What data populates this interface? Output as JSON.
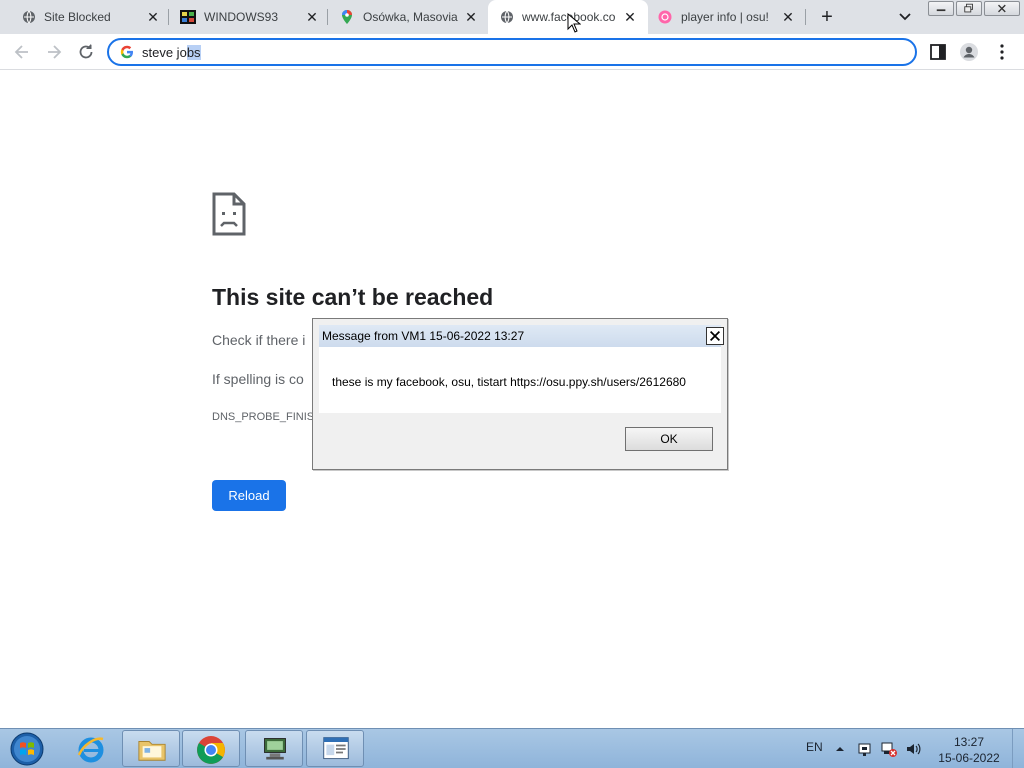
{
  "browser": {
    "tabs": [
      {
        "title": "Site Blocked",
        "icon": "globe-icon"
      },
      {
        "title": "WINDOWS93",
        "icon": "windows93-icon"
      },
      {
        "title": "Osówka, Masovia",
        "icon": "maps-pin-icon"
      },
      {
        "title": "www.facebook.co",
        "icon": "globe-icon",
        "active": true
      },
      {
        "title": "player info | osu!",
        "icon": "osu-icon"
      }
    ],
    "new_tab_label": "+",
    "close_glyph": "✕",
    "omnibox": {
      "text_before_selection": "steve jo",
      "selected_text": "bs"
    }
  },
  "page": {
    "heading": "This site can’t be reached",
    "line1": "Check if there i",
    "line2": "If spelling is co",
    "error_code": "DNS_PROBE_FINISH",
    "reload_label": "Reload"
  },
  "dialog": {
    "title": "Message from VM1 15-06-2022 13:27",
    "close_glyph": "✕",
    "message": "these is my facebook, osu, tistart https://osu.ppy.sh/users/2612680",
    "ok_label": "OK"
  },
  "taskbar": {
    "language": "EN",
    "time": "13:27",
    "date": "15-06-2022",
    "apps": [
      "internet-explorer-icon",
      "file-explorer-icon",
      "chrome-icon",
      "network-tool-icon",
      "window-app-icon"
    ]
  },
  "colors": {
    "accent": "#1a73e8",
    "tabstrip": "#dee1e6",
    "taskbar": "#9dbbdc"
  }
}
